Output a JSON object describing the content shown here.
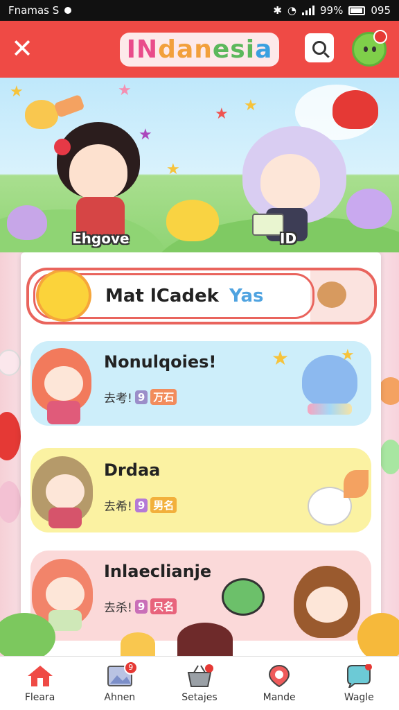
{
  "status_bar": {
    "left_text": "Fnamas S",
    "right_text": "99%",
    "time": "095"
  },
  "header": {
    "title_parts": [
      "IN",
      "dan",
      "esi",
      "a"
    ],
    "close_icon": "close-icon",
    "search_icon": "search-icon",
    "profile_icon": "avatar-icon"
  },
  "banner": {
    "label_left": "Ehgove",
    "label_right": "ID"
  },
  "featured": {
    "title": "Mat lCadek",
    "highlight": "Yas"
  },
  "cards": [
    {
      "title": "Nonulqoies!",
      "sub_prefix": "去考!",
      "tag1": "9",
      "tag2": "万石",
      "bg": "#cdeefa"
    },
    {
      "title": "Drdaa",
      "sub_prefix": "去希!",
      "tag1": "9",
      "tag2": "男名",
      "bg": "#fbf2a2"
    },
    {
      "title": "Inlaeclianje",
      "sub_prefix": "去杀!",
      "tag1": "9",
      "tag2": "只名",
      "bg": "#fbd9d9"
    }
  ],
  "bottom_nav": [
    {
      "label": "Fleara",
      "icon": "home-icon",
      "badge": ""
    },
    {
      "label": "Ahnen",
      "icon": "gallery-icon",
      "badge": "9"
    },
    {
      "label": "Setajes",
      "icon": "basket-icon",
      "badge": ""
    },
    {
      "label": "Mande",
      "icon": "location-icon",
      "badge": ""
    },
    {
      "label": "Wagle",
      "icon": "chat-icon",
      "badge": ""
    }
  ]
}
